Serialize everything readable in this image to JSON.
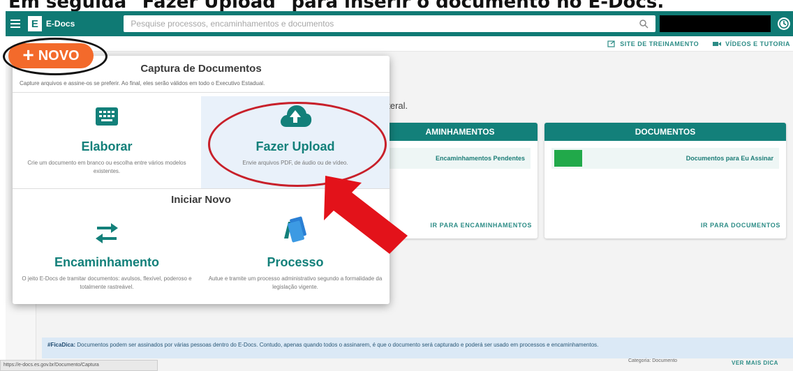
{
  "caption": "Em seguida \"Fazer Upload\" para inserir o documento no E-Docs.",
  "topbar": {
    "logo_mark": "E",
    "logo_text": "E-Docs",
    "search_placeholder": "Pesquise processos, encaminhamentos e documentos"
  },
  "subbar": {
    "training": "SITE DE TREINAMENTO",
    "videos": "VÍDEOS E TUTORIA"
  },
  "novo_button": {
    "plus": "+",
    "label": "NOVO"
  },
  "content": {
    "hint": "ateral."
  },
  "cards": {
    "encaminhamentos": {
      "title": "AMINHAMENTOS",
      "row": "Encaminhamentos Pendentes",
      "link": "IR PARA ENCAMINHAMENTOS"
    },
    "documentos": {
      "title": "DOCUMENTOS",
      "row": "Documentos para Eu Assinar",
      "link": "IR PARA DOCUMENTOS"
    }
  },
  "dropdown": {
    "section1_title": "Captura de Documentos",
    "section1_sub": "Capture arquivos e assine-os se preferir. Ao final, eles serão válidos em todo o Executivo Estadual.",
    "elaborar": {
      "title": "Elaborar",
      "desc": "Crie um documento em branco ou escolha entre vários modelos existentes."
    },
    "upload": {
      "title": "Fazer Upload",
      "desc": "Envie arquivos PDF, de áudio ou de vídeo."
    },
    "section2_title": "Iniciar Novo",
    "encaminhamento": {
      "title": "Encaminhamento",
      "desc": "O jeito E-Docs de tramitar documentos: avulsos, flexível, poderoso e totalmente rastreável."
    },
    "processo": {
      "title": "Processo",
      "desc": "Autue e tramite um processo administrativo segundo a formalidade da legislação vigente."
    }
  },
  "footer": {
    "tag": "#FicaDica:",
    "text": "Documentos podem ser assinados por várias pessoas dentro do E-Docs. Contudo, apenas quando todos o assinarem, é que o documento será capturado e poderá ser usado em processos e encaminhamentos.",
    "meta": "Categoria: Documento",
    "link": "VER MAIS DICA"
  },
  "statusbar": "https://e-docs.es.gov.br/Documento/Captura",
  "colors": {
    "teal": "#13807a",
    "orange": "#f36a2b",
    "annotation_red": "#e3121a"
  }
}
